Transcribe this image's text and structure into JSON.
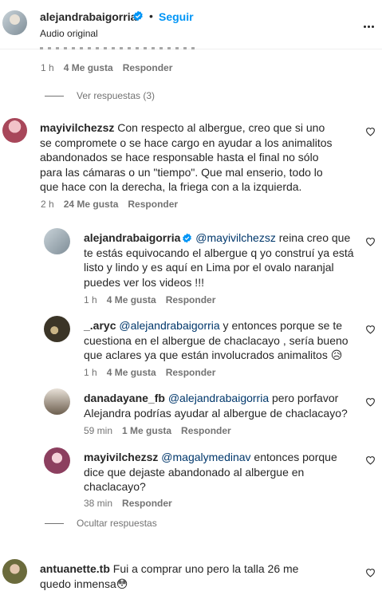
{
  "header": {
    "username": "alejandrabaigorria",
    "separator": "•",
    "follow_label": "Seguir",
    "subtitle": "Audio original"
  },
  "top_comment_meta": {
    "time": "1 h",
    "likes": "4 Me gusta",
    "reply": "Responder"
  },
  "view_replies_label": "Ver respuestas (3)",
  "comments": [
    {
      "username": "mayivilchezsz",
      "text": "Con respecto al albergue, creo que si uno se compromete o se hace cargo en ayudar a los animalitos abandonados se hace responsable hasta el final no sólo para las cámaras o un \"tiempo\". Que mal enserio, todo lo que hace con la derecha, la friega con a la izquierda.",
      "time": "2 h",
      "likes": "24 Me gusta",
      "reply": "Responder"
    }
  ],
  "replies": [
    {
      "username": "alejandrabaigorria",
      "mention": "@mayivilchezsz",
      "text": " reina creo que te estás equivocando el albergue q yo construí ya está listo y lindo y es aquí en Lima por el ovalo naranjal puedes ver los videos !!!",
      "time": "1 h",
      "likes": "4 Me gusta",
      "reply": "Responder"
    },
    {
      "username": "_.aryc",
      "mention": "@alejandrabaigorria",
      "text": " y entonces porque se te cuestiona en el albergue de chaclacayo , sería bueno que aclares ya que están involucrados animalitos 😥",
      "time": "1 h",
      "likes": "4 Me gusta",
      "reply": "Responder"
    },
    {
      "username": "danadayane_fb",
      "mention": "@alejandrabaigorria",
      "text": " pero porfavor Alejandra podrías ayudar al albergue de chaclacayo?",
      "time": "59 min",
      "likes": "1 Me gusta",
      "reply": "Responder"
    },
    {
      "username": "mayivilchezsz",
      "mention": "@magalymedinav",
      "text": " entonces porque dice que dejaste abandonado al albergue en chaclacayo?",
      "time": "38 min",
      "reply": "Responder"
    }
  ],
  "hide_replies_label": "Ocultar respuestas",
  "last_comment": {
    "username": "antuanette.tb",
    "text": "Fui a comprar uno pero la talla 26 me quedo inmensa😳"
  }
}
